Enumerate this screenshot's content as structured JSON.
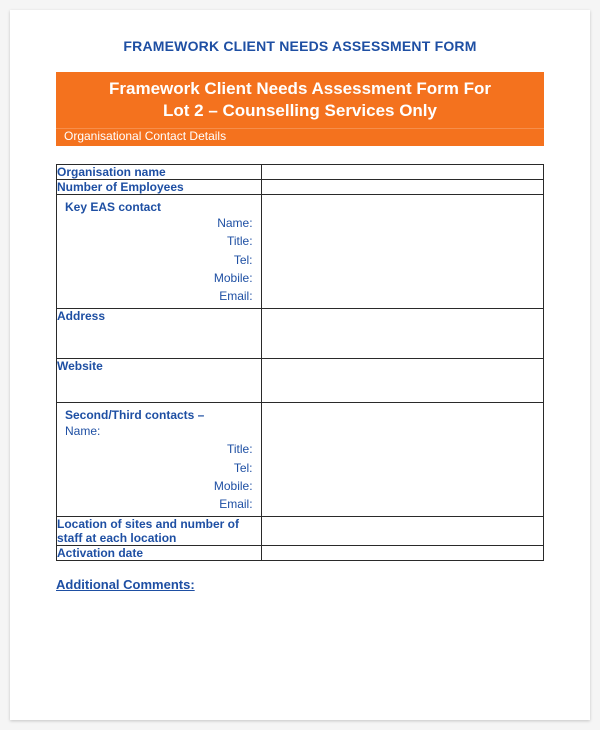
{
  "heading": "FRAMEWORK CLIENT NEEDS ASSESSMENT FORM",
  "banner": {
    "title_line1": "Framework Client Needs Assessment Form For",
    "title_line2": "Lot 2 – Counselling Services Only",
    "subtitle": "Organisational Contact Details"
  },
  "fields": {
    "org_name": "Organisation name",
    "num_employees": "Number of Employees",
    "key_contact": {
      "heading": "Key EAS contact",
      "name": "Name:",
      "title": "Title:",
      "tel": "Tel:",
      "mobile": "Mobile:",
      "email": "Email:"
    },
    "address": "Address",
    "website": "Website",
    "second_contact": {
      "heading": "Second/Third contacts –",
      "name": "Name:",
      "title": "Title:",
      "tel": "Tel:",
      "mobile": "Mobile:",
      "email": "Email:"
    },
    "location_sites": "Location of sites and number of staff at each location",
    "activation_date": "Activation date"
  },
  "footer_link": "Additional Comments:"
}
